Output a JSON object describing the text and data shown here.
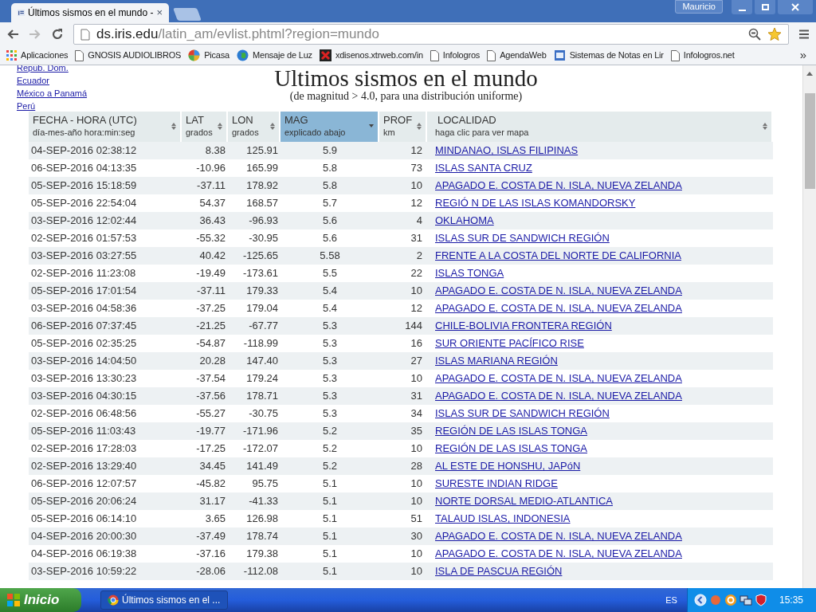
{
  "browser": {
    "tab_title": "Últimos sismos en el mundo -",
    "tab_close": "×",
    "user": "Mauricio",
    "url_host": "ds.iris.edu",
    "url_path": "/latin_am/evlist.phtml?region=mundo",
    "bookmarks": [
      {
        "label": "Aplicaciones",
        "kind": "apps"
      },
      {
        "label": "GNOSIS AUDIOLIBROS",
        "kind": "page"
      },
      {
        "label": "Picasa",
        "kind": "picasa"
      },
      {
        "label": "Mensaje de Luz",
        "kind": "globe"
      },
      {
        "label": "xdisenos.xtrweb.com/in",
        "kind": "dx"
      },
      {
        "label": "Infologros",
        "kind": "page"
      },
      {
        "label": "AgendaWeb",
        "kind": "page"
      },
      {
        "label": "Sistemas de Notas en Lir",
        "kind": "notes"
      },
      {
        "label": "Infologros.net",
        "kind": "page"
      }
    ],
    "bookmarks_more": "»"
  },
  "sidebar_links": [
    "Repub. Dom.",
    "Ecuador",
    "México a Panamá",
    "Perú"
  ],
  "heading": "Ultimos sismos en el mundo",
  "subheading": "(de magnitud > 4.0, para una distribución uniforme)",
  "table": {
    "columns": [
      {
        "title": "FECHA - HORA (UTC)",
        "subtitle": "día-mes-año hora:min:seg",
        "selected": false
      },
      {
        "title": "LAT",
        "subtitle": "grados",
        "selected": false
      },
      {
        "title": "LON",
        "subtitle": "grados",
        "selected": false
      },
      {
        "title": "MAG",
        "subtitle": "explicado abajo",
        "selected": true
      },
      {
        "title": "PROF",
        "subtitle": "km",
        "selected": false
      },
      {
        "title": "LOCALIDAD",
        "subtitle": "haga clic para ver mapa",
        "selected": false
      }
    ],
    "rows": [
      [
        "04-SEP-2016 02:38:12",
        "8.38",
        "125.91",
        "5.9",
        "12",
        "MINDANAO, ISLAS FILIPINAS"
      ],
      [
        "06-SEP-2016 04:13:35",
        "-10.96",
        "165.99",
        "5.8",
        "73",
        "ISLAS SANTA CRUZ"
      ],
      [
        "05-SEP-2016 15:18:59",
        "-37.11",
        "178.92",
        "5.8",
        "10",
        "APAGADO E. COSTA DE N. ISLA, NUEVA ZELANDA"
      ],
      [
        "05-SEP-2016 22:54:04",
        "54.37",
        "168.57",
        "5.7",
        "12",
        "REGIÓ N DE LAS ISLAS KOMANDORSKY"
      ],
      [
        "03-SEP-2016 12:02:44",
        "36.43",
        "-96.93",
        "5.6",
        "4",
        "OKLAHOMA"
      ],
      [
        "02-SEP-2016 01:57:53",
        "-55.32",
        "-30.95",
        "5.6",
        "31",
        "ISLAS SUR DE SANDWICH REGIÓN"
      ],
      [
        "03-SEP-2016 03:27:55",
        "40.42",
        "-125.65",
        "5.58",
        "2",
        "FRENTE A LA COSTA DEL NORTE DE CALIFORNIA"
      ],
      [
        "02-SEP-2016 11:23:08",
        "-19.49",
        "-173.61",
        "5.5",
        "22",
        "ISLAS TONGA"
      ],
      [
        "05-SEP-2016 17:01:54",
        "-37.11",
        "179.33",
        "5.4",
        "10",
        "APAGADO E. COSTA DE N. ISLA, NUEVA ZELANDA"
      ],
      [
        "03-SEP-2016 04:58:36",
        "-37.25",
        "179.04",
        "5.4",
        "12",
        "APAGADO E. COSTA DE N. ISLA, NUEVA ZELANDA"
      ],
      [
        "06-SEP-2016 07:37:45",
        "-21.25",
        "-67.77",
        "5.3",
        "144",
        "CHILE-BOLIVIA FRONTERA REGIÓN"
      ],
      [
        "05-SEP-2016 02:35:25",
        "-54.87",
        "-118.99",
        "5.3",
        "16",
        "SUR ORIENTE PACÍFICO RISE"
      ],
      [
        "03-SEP-2016 14:04:50",
        "20.28",
        "147.40",
        "5.3",
        "27",
        "ISLAS MARIANA REGIÓN"
      ],
      [
        "03-SEP-2016 13:30:23",
        "-37.54",
        "179.24",
        "5.3",
        "10",
        "APAGADO E. COSTA DE N. ISLA, NUEVA ZELANDA"
      ],
      [
        "03-SEP-2016 04:30:15",
        "-37.56",
        "178.71",
        "5.3",
        "31",
        "APAGADO E. COSTA DE N. ISLA, NUEVA ZELANDA"
      ],
      [
        "02-SEP-2016 06:48:56",
        "-55.27",
        "-30.75",
        "5.3",
        "34",
        "ISLAS SUR DE SANDWICH REGIÓN"
      ],
      [
        "05-SEP-2016 11:03:43",
        "-19.77",
        "-171.96",
        "5.2",
        "35",
        "REGIÓN DE LAS ISLAS TONGA"
      ],
      [
        "02-SEP-2016 17:28:03",
        "-17.25",
        "-172.07",
        "5.2",
        "10",
        "REGIÓN DE LAS ISLAS TONGA"
      ],
      [
        "02-SEP-2016 13:29:40",
        "34.45",
        "141.49",
        "5.2",
        "28",
        "AL ESTE DE HONSHU, JAPóN"
      ],
      [
        "06-SEP-2016 12:07:57",
        "-45.82",
        "95.75",
        "5.1",
        "10",
        "SURESTE INDIAN RIDGE"
      ],
      [
        "05-SEP-2016 20:06:24",
        "31.17",
        "-41.33",
        "5.1",
        "10",
        "NORTE DORSAL MEDIO-ATLANTICA"
      ],
      [
        "05-SEP-2016 06:14:10",
        "3.65",
        "126.98",
        "5.1",
        "51",
        "TALAUD ISLAS, INDONESIA"
      ],
      [
        "04-SEP-2016 20:00:30",
        "-37.49",
        "178.74",
        "5.1",
        "30",
        "APAGADO E. COSTA DE N. ISLA, NUEVA ZELANDA"
      ],
      [
        "04-SEP-2016 06:19:38",
        "-37.16",
        "179.38",
        "5.1",
        "10",
        "APAGADO E. COSTA DE N. ISLA, NUEVA ZELANDA"
      ],
      [
        "03-SEP-2016 10:59:22",
        "-28.06",
        "-112.08",
        "5.1",
        "10",
        "ISLA DE PASCUA REGIÓN"
      ]
    ]
  },
  "taskbar": {
    "start": "Inicio",
    "task": "Últimos sismos en el ...",
    "language": "ES",
    "clock": "15:35"
  }
}
